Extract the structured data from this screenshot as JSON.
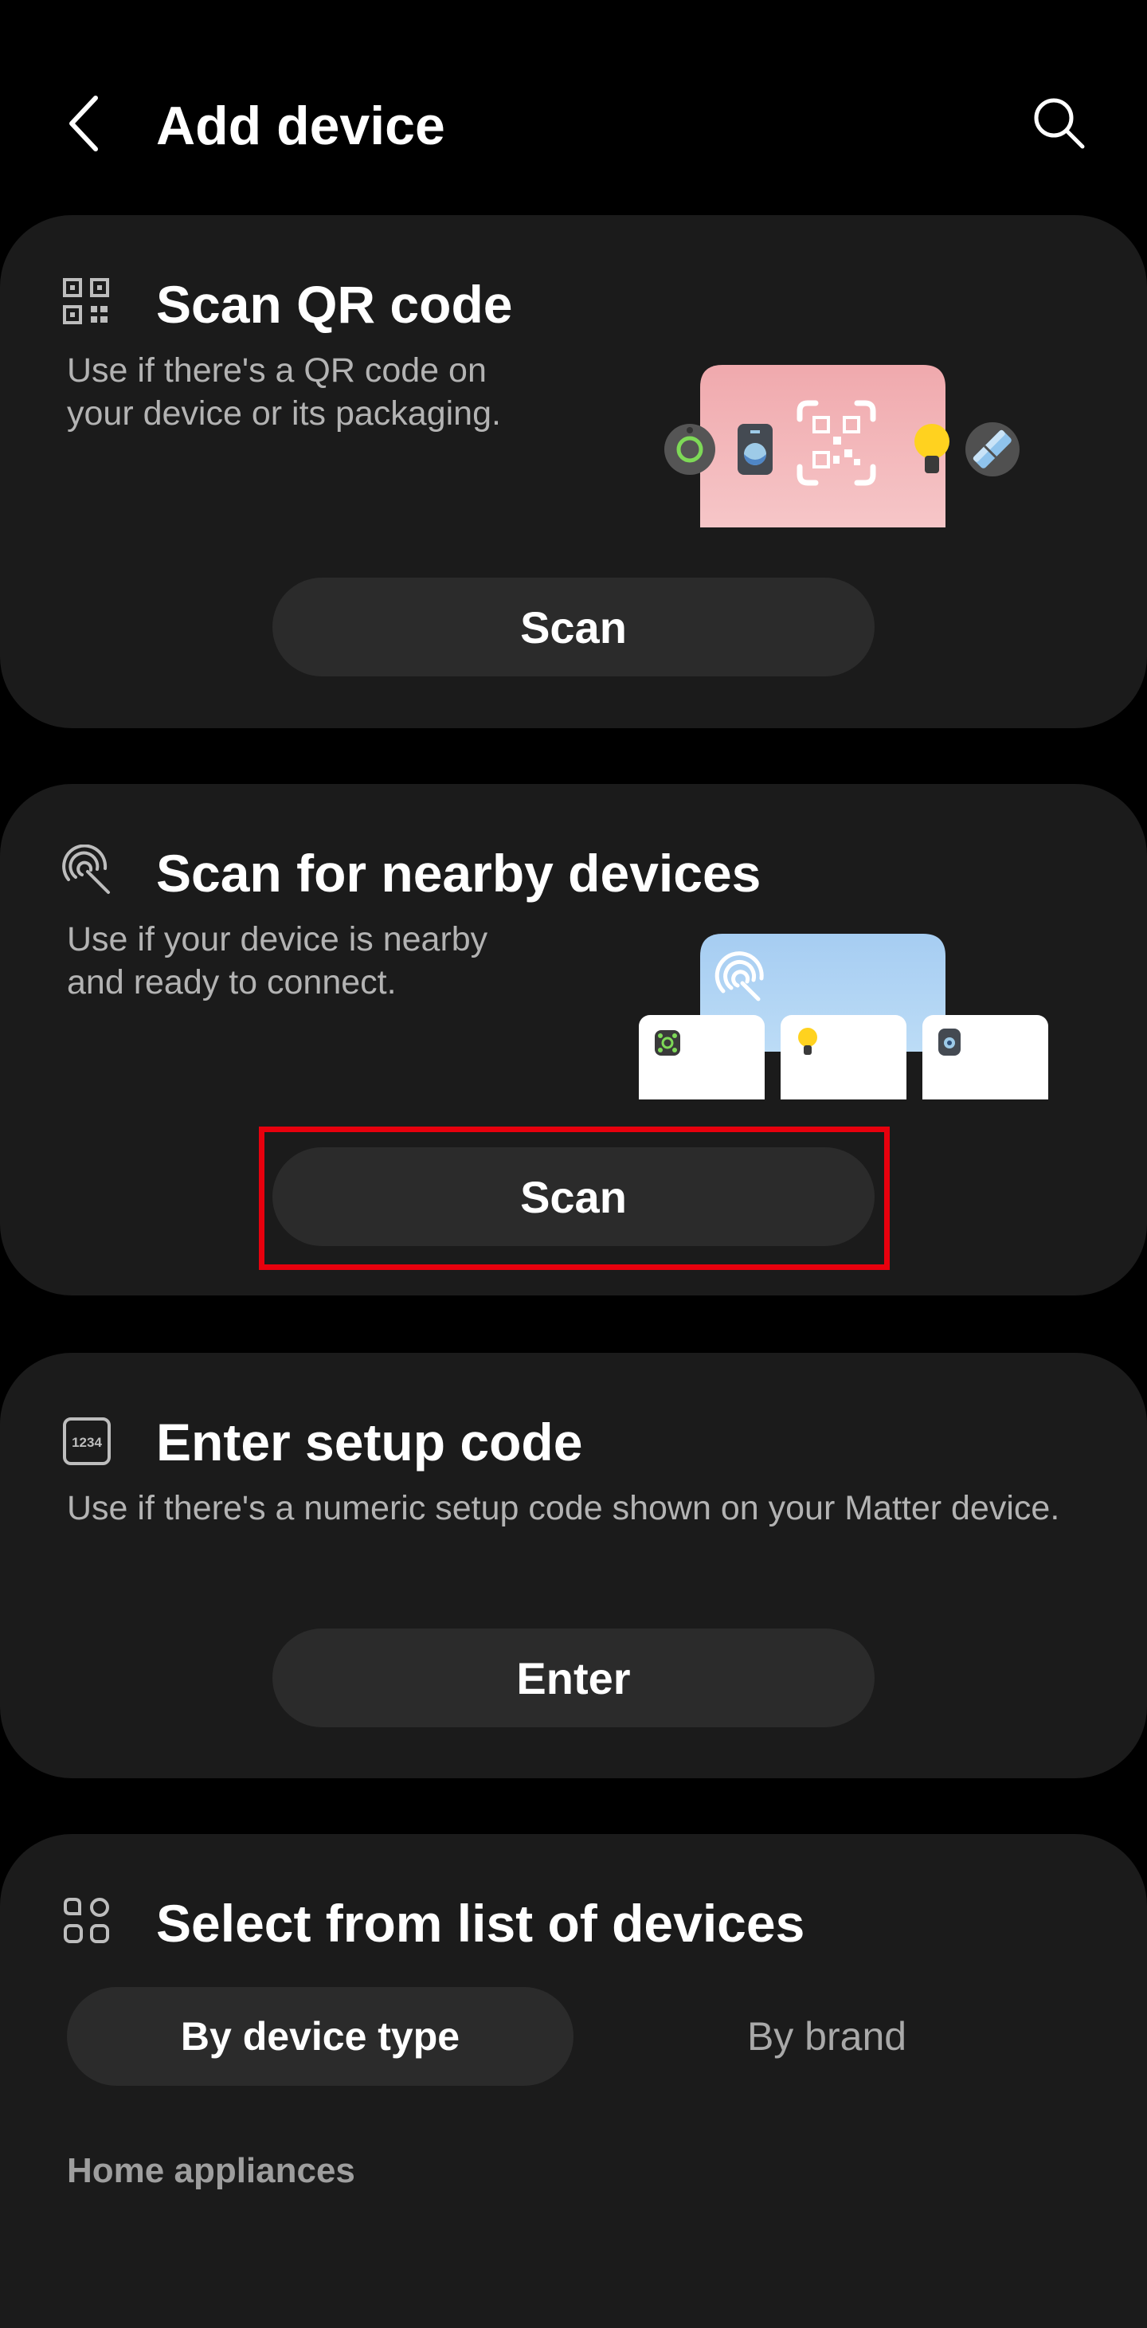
{
  "header": {
    "title": "Add device"
  },
  "qr_card": {
    "title": "Scan QR code",
    "description_line1": "Use if there's a QR code on",
    "description_line2": "your device or its packaging.",
    "button_label": "Scan"
  },
  "nearby_card": {
    "title": "Scan for nearby devices",
    "description_line1": "Use if your device is nearby",
    "description_line2": "and ready to connect.",
    "button_label": "Scan"
  },
  "setup_code_card": {
    "icon_text": "1234",
    "title": "Enter setup code",
    "description": "Use if there's a numeric setup code shown on your Matter device.",
    "button_label": "Enter"
  },
  "device_list_card": {
    "title": "Select from list of devices",
    "tabs": [
      {
        "label": "By device type",
        "selected": true
      },
      {
        "label": "By brand",
        "selected": false
      }
    ],
    "section_label": "Home appliances"
  },
  "colors": {
    "background": "#000000",
    "card": "#1b1b1b",
    "button": "#2b2b2b",
    "highlight": "#e8000d",
    "qr_illustration": "#f2b8bb",
    "nearby_illustration": "#a9d0f2"
  }
}
